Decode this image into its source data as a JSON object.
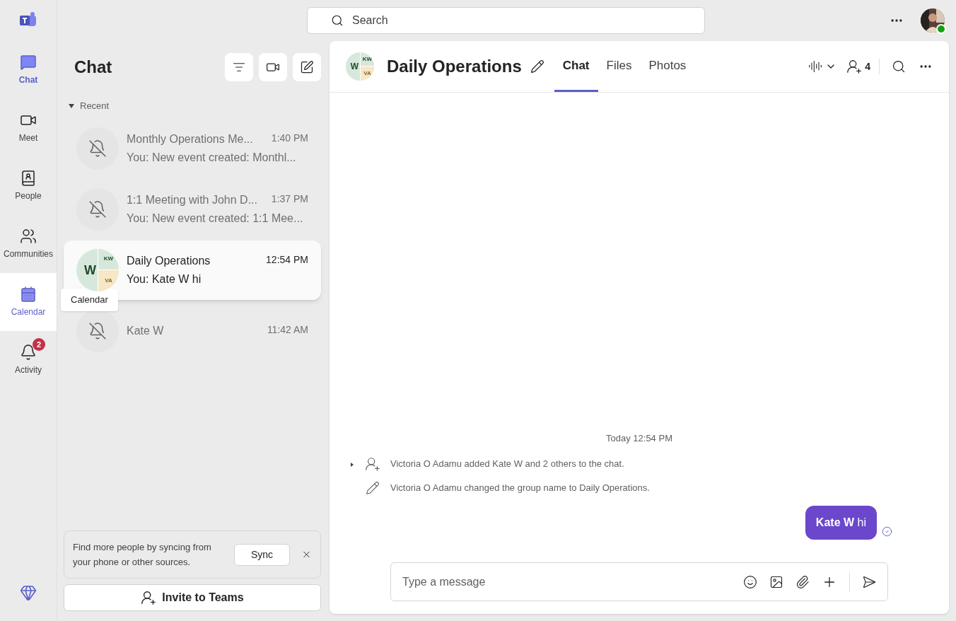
{
  "rail": [
    {
      "label": "Chat",
      "kind": "chat",
      "selected": true,
      "hovered": false
    },
    {
      "label": "Meet",
      "kind": "meet",
      "selected": false,
      "hovered": false
    },
    {
      "label": "People",
      "kind": "people",
      "selected": false,
      "hovered": false
    },
    {
      "label": "Communities",
      "kind": "communities",
      "selected": false,
      "hovered": false
    },
    {
      "label": "Calendar",
      "kind": "calendar",
      "selected": false,
      "hovered": true
    },
    {
      "label": "Activity",
      "kind": "activity",
      "selected": false,
      "hovered": false,
      "badge": "2"
    }
  ],
  "tooltip": "Calendar",
  "search": {
    "placeholder": "Search"
  },
  "chat_list": {
    "title": "Chat",
    "section": "Recent",
    "expanded": true,
    "items": [
      {
        "kind": "muted",
        "name": "Monthly Operations Me...",
        "time": "1:40 PM",
        "preview": "You: New event created: Monthl...",
        "selected": false
      },
      {
        "kind": "muted",
        "name": "1:1 Meeting with John D...",
        "time": "1:37 PM",
        "preview": "You: New event created: 1:1 Mee...",
        "selected": false
      },
      {
        "kind": "group",
        "name": "Daily Operations",
        "time": "12:54 PM",
        "preview": "You: Kate W hi",
        "selected": true,
        "initials": [
          "W",
          "KW",
          "VA"
        ]
      },
      {
        "kind": "muted",
        "name": "Kate W",
        "time": "11:42 AM",
        "selected": false
      }
    ],
    "sync_card": {
      "text": "Find more people by syncing from your phone or other sources.",
      "button": "Sync"
    },
    "invite_button": "Invite to Teams"
  },
  "conversation": {
    "avatar_initials": [
      "W",
      "KW",
      "VA"
    ],
    "title": "Daily Operations",
    "tabs": [
      {
        "label": "Chat",
        "selected": true
      },
      {
        "label": "Files",
        "selected": false
      },
      {
        "label": "Photos",
        "selected": false
      }
    ],
    "participants": "4",
    "timestamp": "Today 12:54 PM",
    "events": [
      {
        "kind": "added",
        "text": "Victoria O Adamu added Kate W and 2 others to the chat."
      },
      {
        "kind": "renamed",
        "text": "Victoria O Adamu changed the group name to Daily Operations."
      }
    ],
    "messages": [
      {
        "text": "**Kate W** hi",
        "seen": true
      }
    ],
    "composer": {
      "placeholder": "Type a message"
    }
  }
}
